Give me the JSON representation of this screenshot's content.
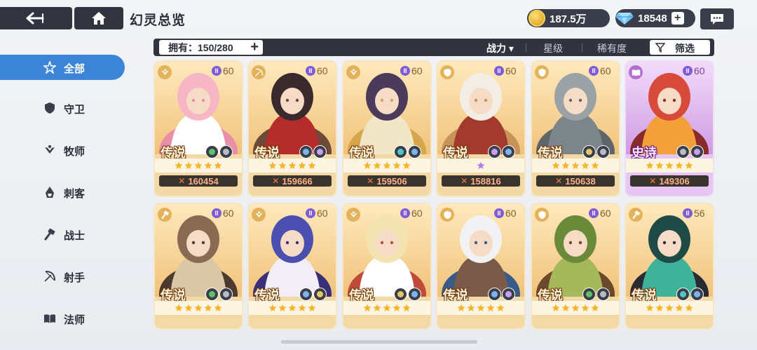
{
  "header": {
    "title": "幻灵总览",
    "gold": "187.5万",
    "gems": "18548",
    "plus": "+"
  },
  "sidebar": {
    "items": [
      {
        "label": "全部",
        "icon": "star-outline-icon",
        "active": true
      },
      {
        "label": "守卫",
        "icon": "shield-icon",
        "active": false
      },
      {
        "label": "牧师",
        "icon": "wing-icon",
        "active": false
      },
      {
        "label": "刺客",
        "icon": "hood-icon",
        "active": false
      },
      {
        "label": "战士",
        "icon": "hammer-icon",
        "active": false
      },
      {
        "label": "射手",
        "icon": "bow-icon",
        "active": false
      },
      {
        "label": "法师",
        "icon": "book-icon",
        "active": false
      }
    ]
  },
  "filterbar": {
    "owned_label": "拥有：150/280",
    "sort_power": "战力 ▾",
    "sort_star": "星级",
    "sort_rarity": "稀有度",
    "filter": "筛选"
  },
  "cards": [
    {
      "rarity": "传说",
      "level": "60",
      "power": "160454",
      "stars": 5,
      "tier": "legend",
      "class_icon": "wing-icon",
      "elements": [
        "nature-icon",
        "spiral-icon"
      ],
      "palette": [
        "#f7b6c6",
        "#ffffff",
        "#e98fa8"
      ]
    },
    {
      "rarity": "传说",
      "level": "60",
      "power": "159666",
      "stars": 5,
      "tier": "legend",
      "class_icon": "bow-icon",
      "elements": [
        "holy-icon",
        "eye-icon"
      ],
      "palette": [
        "#3a2a2e",
        "#b52c2c",
        "#6b4a3a"
      ]
    },
    {
      "rarity": "传说",
      "level": "60",
      "power": "159506",
      "stars": 5,
      "tier": "legend",
      "class_icon": "wing-icon",
      "elements": [
        "water-icon",
        "holy-icon"
      ],
      "palette": [
        "#4b3a5a",
        "#f2e6c8",
        "#d6a64a"
      ]
    },
    {
      "rarity": "传说",
      "level": "60",
      "power": "158816",
      "stars": 1,
      "tier": "legend",
      "class_icon": "shield-icon",
      "elements": [
        "eye-icon",
        "holy-icon"
      ],
      "palette": [
        "#f2eee6",
        "#a33a2e",
        "#c8935a"
      ]
    },
    {
      "rarity": "传说",
      "level": "60",
      "power": "150638",
      "stars": 5,
      "tier": "legend",
      "class_icon": "shield-icon",
      "elements": [
        "wing-icon",
        "spiral-icon"
      ],
      "palette": [
        "#9aa2a6",
        "#7c858a",
        "#5f6669"
      ]
    },
    {
      "rarity": "史诗",
      "level": "60",
      "power": "149306",
      "stars": 5,
      "tier": "epic",
      "class_icon": "book-icon",
      "elements": [
        "spiral-icon",
        "eye-icon"
      ],
      "palette": [
        "#d84a3a",
        "#f3a03a",
        "#8a2a2a"
      ]
    },
    {
      "rarity": "传说",
      "level": "60",
      "power": "",
      "stars": 5,
      "tier": "legend",
      "class_icon": "hammer-icon",
      "elements": [
        "nature-icon",
        "spiral-icon"
      ],
      "palette": [
        "#8a6a52",
        "#d9c7a5",
        "#4a3a30"
      ]
    },
    {
      "rarity": "传说",
      "level": "60",
      "power": "",
      "stars": 5,
      "tier": "legend",
      "class_icon": "wing-icon",
      "elements": [
        "holy-icon",
        "wing-icon"
      ],
      "palette": [
        "#4a4fb0",
        "#f2eef8",
        "#3a2e7a"
      ]
    },
    {
      "rarity": "传说",
      "level": "60",
      "power": "",
      "stars": 5,
      "tier": "legend",
      "class_icon": "wing-icon",
      "elements": [
        "wing-icon",
        "holy-icon"
      ],
      "palette": [
        "#f3e3b0",
        "#ffffff",
        "#c04a3a"
      ]
    },
    {
      "rarity": "传说",
      "level": "60",
      "power": "",
      "stars": 5,
      "tier": "legend",
      "class_icon": "shield-icon",
      "elements": [
        "holy-icon",
        "eye-icon"
      ],
      "palette": [
        "#f2f2f4",
        "#7a5a4a",
        "#3a5a8a"
      ]
    },
    {
      "rarity": "传说",
      "level": "60",
      "power": "",
      "stars": 5,
      "tier": "legend",
      "class_icon": "shield-icon",
      "elements": [
        "nature-icon",
        "spiral-icon"
      ],
      "palette": [
        "#6a8a3a",
        "#a5b85a",
        "#6a4a2a"
      ]
    },
    {
      "rarity": "传说",
      "level": "56",
      "power": "",
      "stars": 5,
      "tier": "legend",
      "class_icon": "hammer-icon",
      "elements": [
        "water-icon",
        "holy-icon"
      ],
      "palette": [
        "#1f4a46",
        "#3fb39a",
        "#2a2a32"
      ]
    }
  ],
  "colors": {
    "accent": "#3b84d8",
    "dark_bar": "#31343e",
    "legend_frame": "#f3d9a6",
    "epic_frame": "#e7c7f2"
  }
}
